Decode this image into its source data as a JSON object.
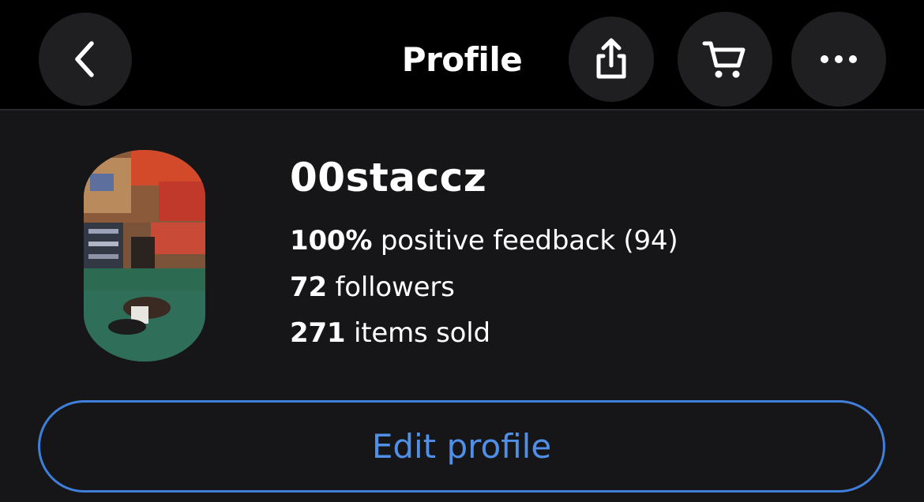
{
  "header": {
    "title": "Profile",
    "back_icon": "chevron-left-icon",
    "share_icon": "share-icon",
    "cart_icon": "cart-icon",
    "more_icon": "more-horizontal-icon"
  },
  "profile": {
    "username": "00staccz",
    "feedback": {
      "percent": "100%",
      "text": "positive feedback (94)"
    },
    "followers": {
      "count": "72",
      "text": "followers"
    },
    "sold": {
      "count": "271",
      "text": "items sold"
    }
  },
  "actions": {
    "edit_label": "Edit profile"
  },
  "colors": {
    "background": "#161618",
    "header_background": "#000000",
    "button_background": "#1f1f21",
    "accent": "#4f8fe6"
  }
}
